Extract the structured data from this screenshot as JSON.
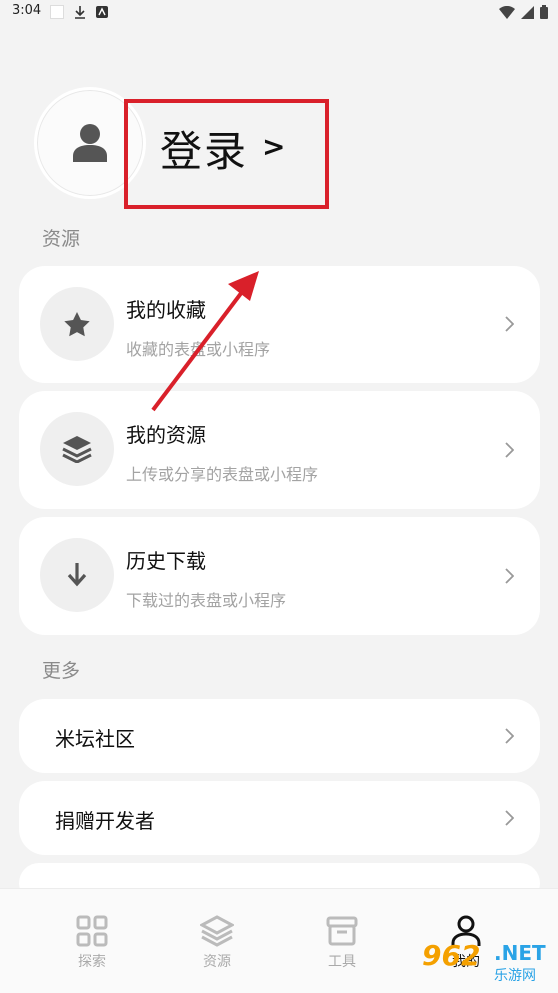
{
  "status": {
    "time": "3:04"
  },
  "profile": {
    "login_label": "登录",
    "login_arrow": ">"
  },
  "sections": {
    "resources": "资源",
    "more": "更多"
  },
  "resource_cards": [
    {
      "title": "我的收藏",
      "subtitle": "收藏的表盘或小程序",
      "icon": "star-icon"
    },
    {
      "title": "我的资源",
      "subtitle": "上传或分享的表盘或小程序",
      "icon": "layers-icon"
    },
    {
      "title": "历史下载",
      "subtitle": "下载过的表盘或小程序",
      "icon": "download-arrow-icon"
    }
  ],
  "more_items": [
    {
      "title": "米坛社区"
    },
    {
      "title": "捐赠开发者"
    }
  ],
  "bottom_nav": [
    {
      "label": "探索",
      "icon": "grid-icon"
    },
    {
      "label": "资源",
      "icon": "layers-icon"
    },
    {
      "label": "工具",
      "icon": "archive-icon"
    },
    {
      "label": "我的",
      "icon": "person-icon",
      "active": true
    }
  ],
  "watermark": {
    "brand": "962",
    "suffix": ".NET",
    "cn": "乐游网"
  },
  "colors": {
    "annotation_red": "#d9202a",
    "background": "#f3f3f3"
  }
}
